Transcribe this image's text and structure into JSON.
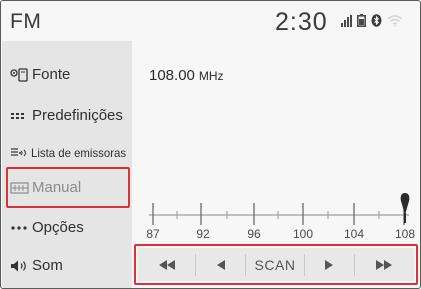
{
  "header": {
    "source": "FM",
    "clock": "2:30"
  },
  "status_icons": [
    "signal-bars-icon",
    "battery-icon",
    "bluetooth-icon",
    "wifi-icon"
  ],
  "sidebar": {
    "items": [
      {
        "label": "Fonte",
        "icon": "source-icon"
      },
      {
        "label": "Predefinições",
        "icon": "presets-icon"
      },
      {
        "label": "Lista de emissoras",
        "icon": "station-list-icon"
      },
      {
        "label": "Manual",
        "icon": "manual-tuning-icon",
        "highlighted": true
      },
      {
        "label": "Opções",
        "icon": "more-options-icon"
      },
      {
        "label": "Som",
        "icon": "speaker-icon"
      }
    ]
  },
  "tuner": {
    "frequency": "108.00",
    "unit": "MHz",
    "scale_labels": [
      "87",
      "92",
      "96",
      "100",
      "104",
      "108"
    ]
  },
  "controls": {
    "seek_back_icon": "fast-backward-icon",
    "tune_down_icon": "step-left-icon",
    "scan_label": "SCAN",
    "tune_up_icon": "step-right-icon",
    "seek_forward_icon": "fast-forward-icon"
  },
  "colors": {
    "highlight": "#d8333d",
    "sidebar_bg": "#e5e5e5",
    "screen_bg": "#f7f7f7"
  }
}
